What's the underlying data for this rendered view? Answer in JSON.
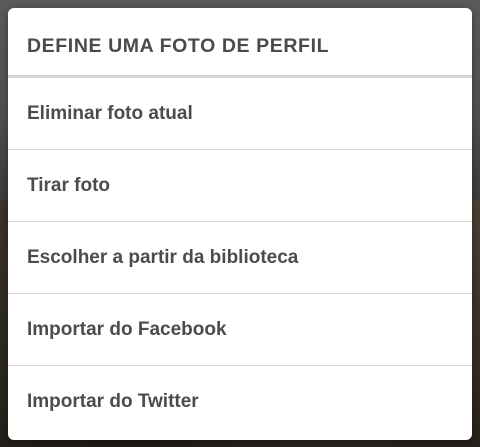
{
  "dialog": {
    "title": "DEFINE UMA FOTO DE PERFIL",
    "options": [
      {
        "label": "Eliminar foto atual"
      },
      {
        "label": "Tirar foto"
      },
      {
        "label": "Escolher a partir da biblioteca"
      },
      {
        "label": "Importar do Facebook"
      },
      {
        "label": "Importar do Twitter"
      }
    ]
  }
}
